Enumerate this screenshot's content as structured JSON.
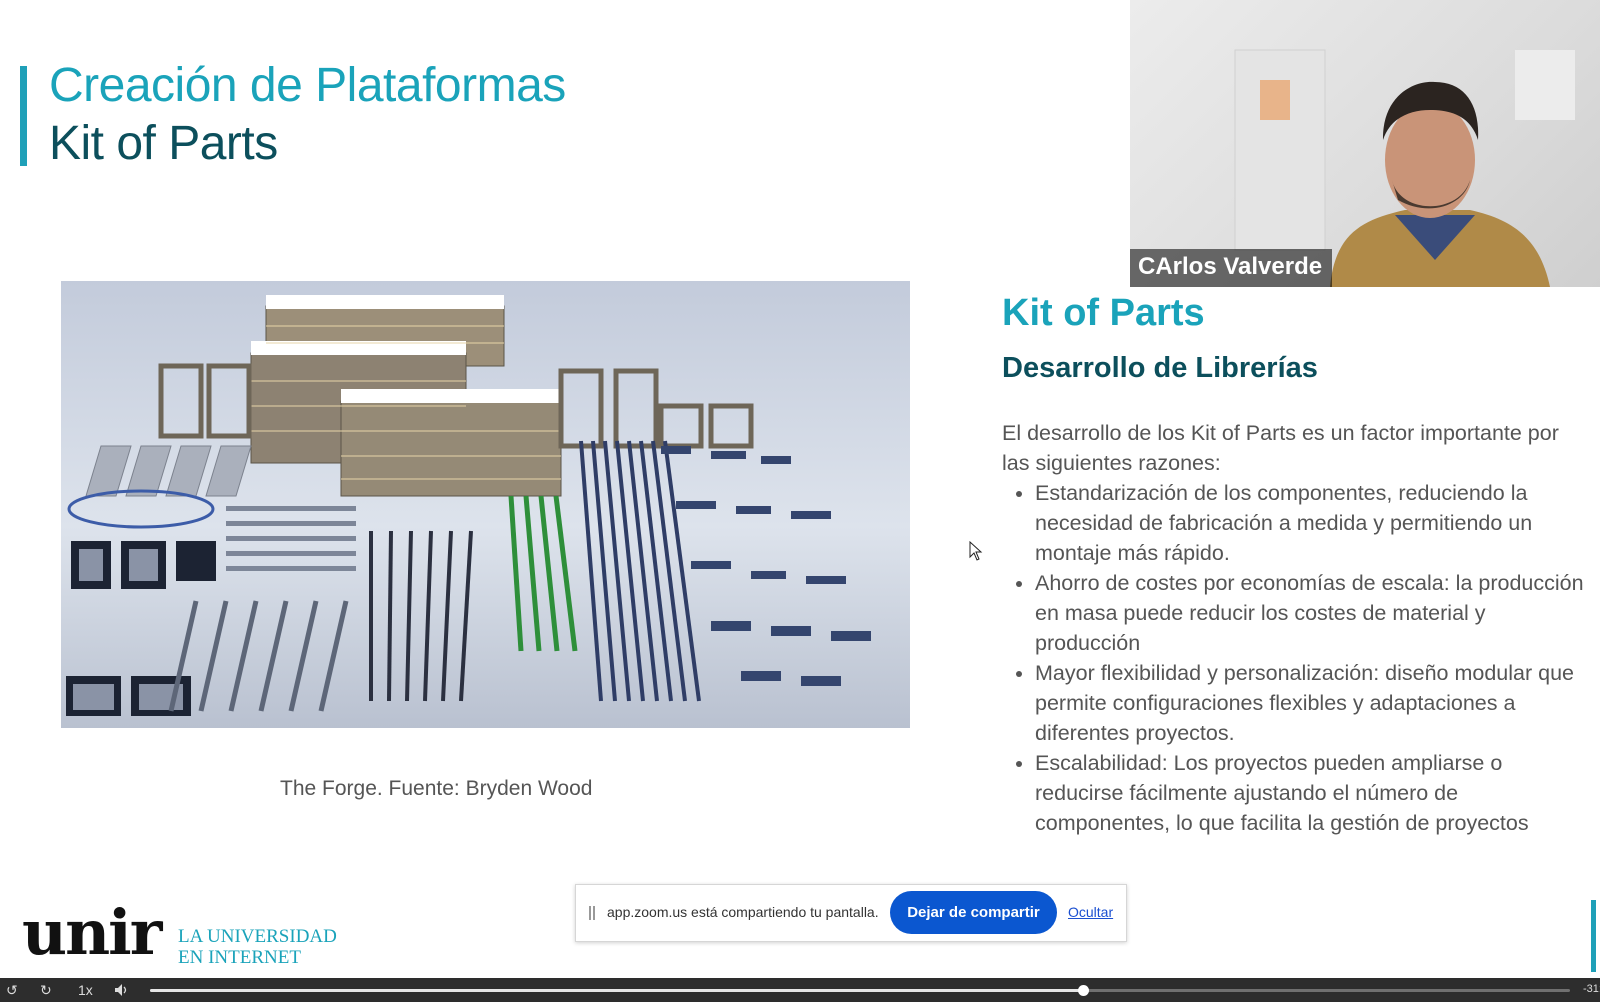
{
  "slide": {
    "title_line1": "Creación de Plataformas",
    "title_line2": "Kit of Parts",
    "image_caption": "The Forge. Fuente: Bryden Wood",
    "section_heading": "Kit of Parts",
    "subheading": "Desarrollo de Librerías",
    "intro": "El desarrollo de los Kit of Parts es un factor importante por las siguientes razones:",
    "bullets": [
      "Estandarización de los componentes, reduciendo la necesidad de fabricación a medida y permitiendo un montaje más rápido.",
      "Ahorro de costes por economías de escala: la producción en masa puede reducir los costes de material y producción",
      "Mayor flexibilidad y personalización: diseño modular que permite configuraciones flexibles y adaptaciones a diferentes proyectos.",
      "Escalabilidad: Los proyectos pueden ampliarse o reducirse fácilmente ajustando el número de componentes, lo que facilita la gestión de proyectos"
    ],
    "brand_colors": {
      "teal": "#1aa3ba",
      "dark_teal": "#0c4f5c"
    }
  },
  "video": {
    "participant_name": "CArlos Valverde"
  },
  "branding": {
    "logo_text": "unir",
    "tagline_line1": "LA UNIVERSIDAD",
    "tagline_line2": "EN INTERNET"
  },
  "share_bar": {
    "message": "app.zoom.us está compartiendo tu pantalla.",
    "stop_label": "Dejar de compartir",
    "hide_label": "Ocultar",
    "button_color": "#0b57d0"
  },
  "player": {
    "rewind_icon": "rewind-icon",
    "forward_icon": "forward-icon",
    "speed": "1x",
    "volume_icon": "volume-icon",
    "progress": 0.657,
    "time_remaining": "-31:"
  }
}
